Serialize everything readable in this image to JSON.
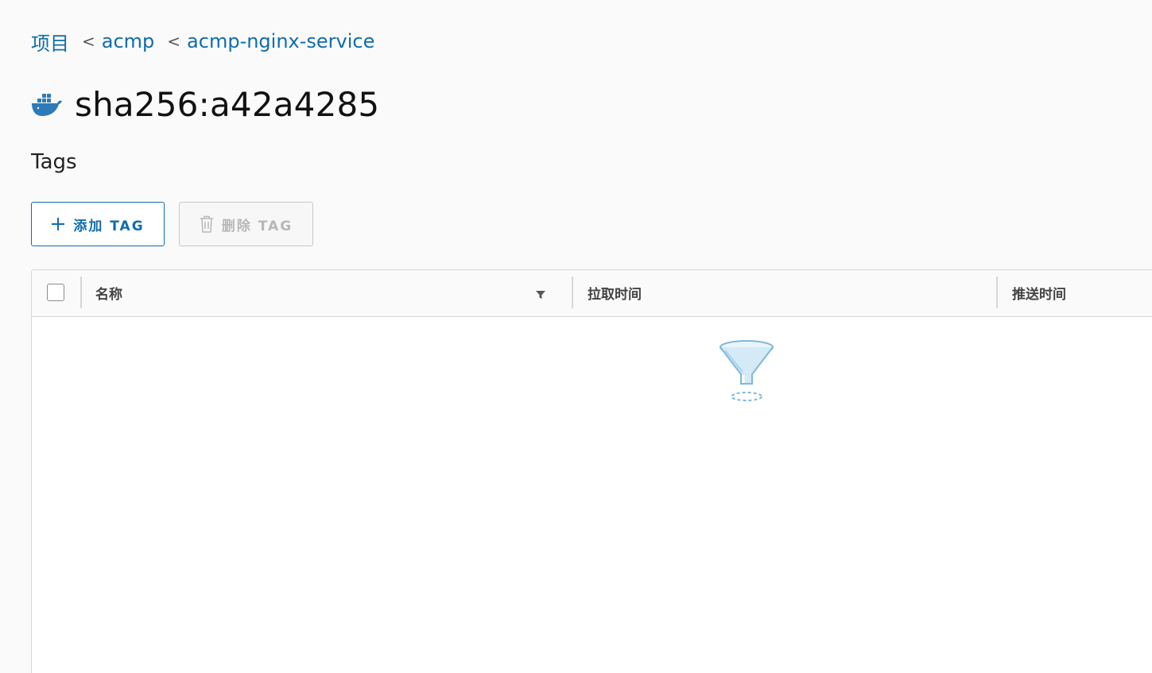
{
  "breadcrumb": {
    "items": [
      "项目",
      "acmp",
      "acmp-nginx-service"
    ],
    "separator": "<"
  },
  "title": "sha256:a42a4285",
  "title_icon": "docker-whale-icon",
  "section_label": "Tags",
  "toolbar": {
    "add_label": "添加 TAG",
    "add_icon": "plus-icon",
    "delete_label": "删除 TAG",
    "delete_icon": "trash-icon",
    "delete_disabled": true
  },
  "grid": {
    "columns": [
      "名称",
      "拉取时间",
      "推送时间"
    ],
    "rows": [],
    "empty_icon": "funnel-empty-icon"
  },
  "colors": {
    "accent": "#0f6dae",
    "disabled": "#b8b8b8",
    "border": "#d7d7d7",
    "background": "#fafafa"
  }
}
